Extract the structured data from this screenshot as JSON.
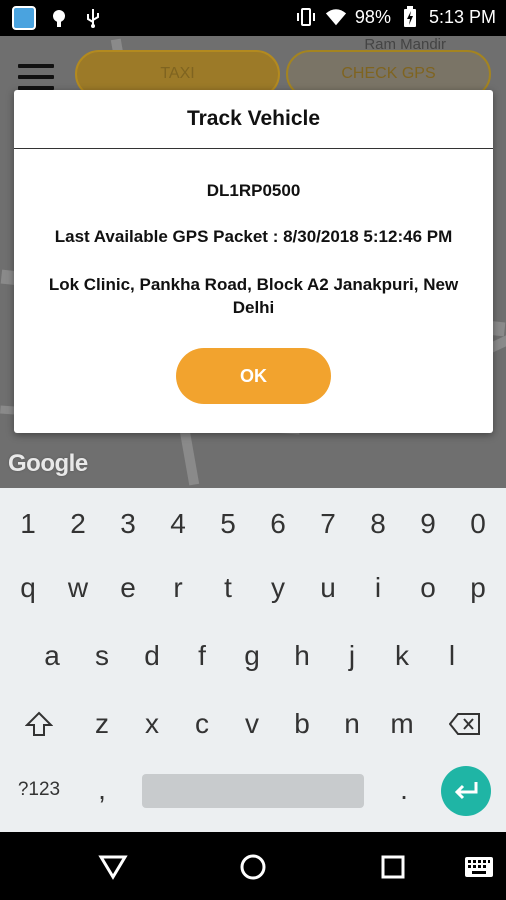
{
  "status_bar": {
    "battery": "98%",
    "time": "5:13 PM"
  },
  "map": {
    "tabs": [
      "TAXI",
      "CHECK GPS"
    ],
    "place_label": "Ram Mandir",
    "attribution": "Google"
  },
  "dialog": {
    "title": "Track Vehicle",
    "vehicle_number": "DL1RP0500",
    "gps_packet": "Last Available GPS Packet : 8/30/2018 5:12:46 PM",
    "address": "Lok Clinic, Pankha Road, Block A2 Janakpuri, New Delhi",
    "ok_label": "OK"
  },
  "keyboard": {
    "row_numbers": [
      "1",
      "2",
      "3",
      "4",
      "5",
      "6",
      "7",
      "8",
      "9",
      "0"
    ],
    "row_1": [
      "q",
      "w",
      "e",
      "r",
      "t",
      "y",
      "u",
      "i",
      "o",
      "p"
    ],
    "row_2": [
      "a",
      "s",
      "d",
      "f",
      "g",
      "h",
      "j",
      "k",
      "l"
    ],
    "row_3": [
      "z",
      "x",
      "c",
      "v",
      "b",
      "n",
      "m"
    ],
    "symbols_label": "?123",
    "comma": ",",
    "period": "."
  },
  "colors": {
    "accent_orange": "#f2a32e",
    "enter_teal": "#1fb5a5"
  }
}
